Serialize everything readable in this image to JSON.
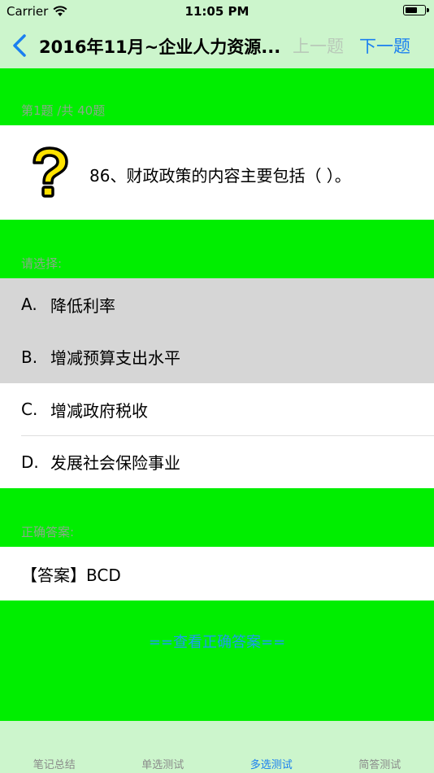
{
  "status": {
    "carrier": "Carrier",
    "time": "11:05 PM"
  },
  "nav": {
    "title": "2016年11月~企业人力资源...",
    "prev_label": "上一题",
    "next_label": "下一题"
  },
  "progress": "第1题 /共 40题",
  "question": {
    "text": "86、财政政策的内容主要包括（  ）。"
  },
  "choose_label": "请选择:",
  "options": [
    {
      "letter": "A.",
      "text": "降低利率",
      "selected": true
    },
    {
      "letter": "B.",
      "text": "增减预算支出水平",
      "selected": true
    },
    {
      "letter": "C.",
      "text": "增减政府税收",
      "selected": false
    },
    {
      "letter": "D.",
      "text": "发展社会保险事业",
      "selected": false
    }
  ],
  "answer_label": "正确答案:",
  "answer_text": "【答案】BCD",
  "view_answer_button": "==查看正确答案==",
  "tabs": [
    {
      "label": "笔记总结",
      "active": false
    },
    {
      "label": "单选测试",
      "active": false
    },
    {
      "label": "多选测试",
      "active": true
    },
    {
      "label": "简答测试",
      "active": false
    }
  ],
  "colors": {
    "band": "#00ee00",
    "background": "#ccf5cc",
    "accent": "#1a7ff0",
    "selected_row": "#d6d6d6"
  }
}
